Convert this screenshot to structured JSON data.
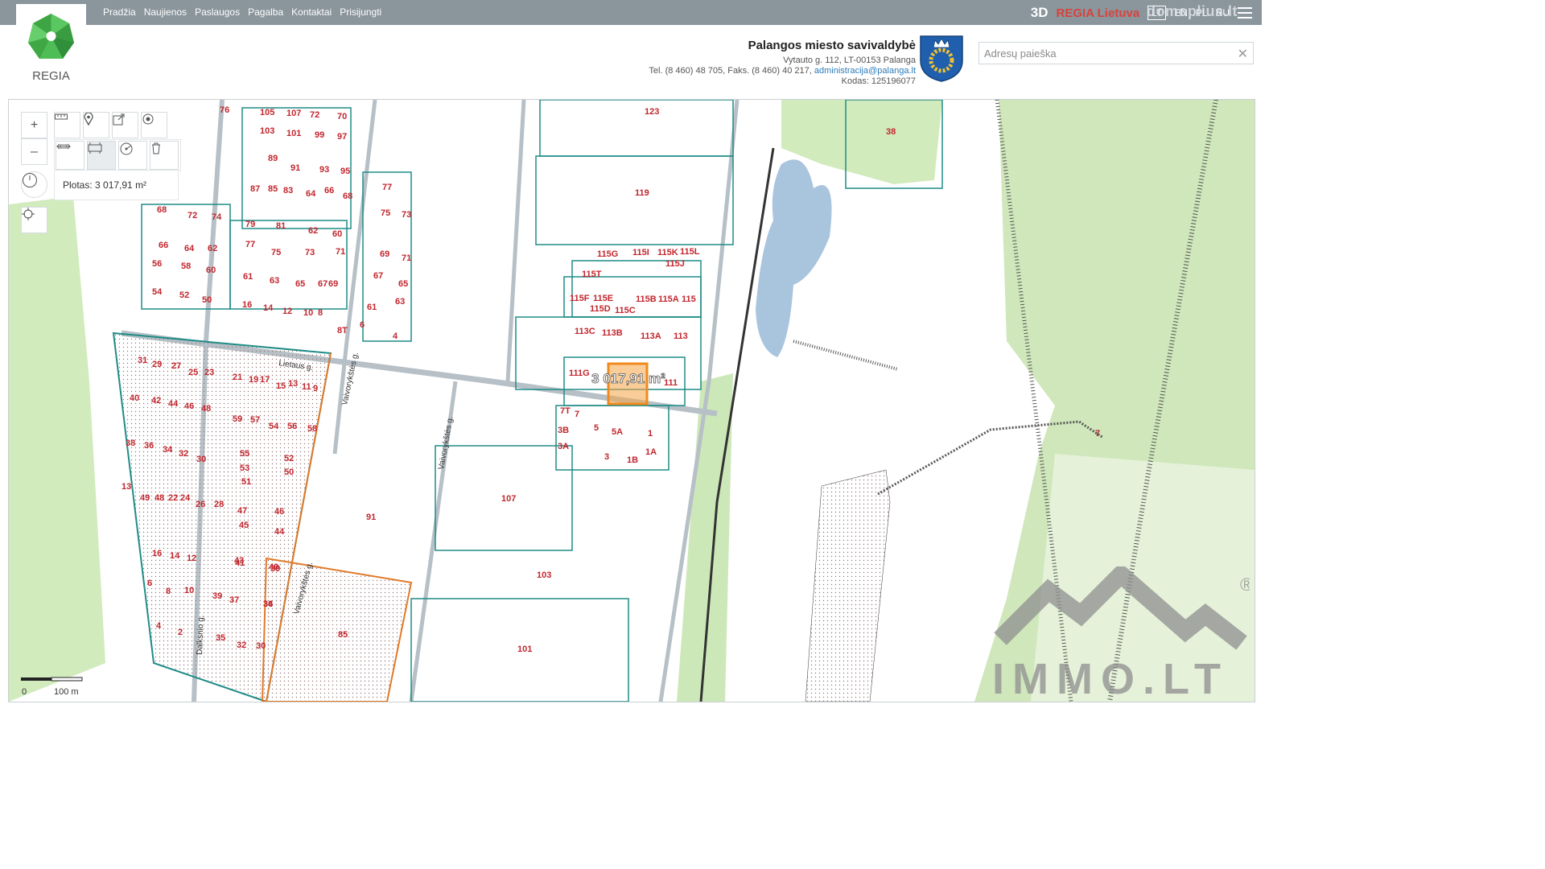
{
  "nav": {
    "items": [
      "Pradžia",
      "Naujienos",
      "Paslaugos",
      "Pagalba",
      "Kontaktai",
      "Prisijungti"
    ]
  },
  "topbar": {
    "btn_3d": "3D",
    "regia_lietuva": "REGIA Lietuva",
    "lang_active": "LT",
    "lang_others": [
      "EN",
      "PL",
      "RU"
    ],
    "watermark": "domoplius.lt",
    "menu_icon": "hamburger-menu-icon"
  },
  "logo": {
    "text": "REGIA",
    "colors": {
      "green": "#44b54b",
      "dark_green": "#2f8f3a"
    }
  },
  "municipality": {
    "name": "Palangos miesto savivaldybė",
    "address": "Vytauto g. 112, LT-00153 Palanga",
    "phone_line": "Tel. (8 460) 48 705, Faks. (8 460) 40 217,",
    "email": "administracija@palanga.lt",
    "code": "Kodas: 125196077",
    "coat_of_arms": "coat-of-arms-icon"
  },
  "search": {
    "placeholder": "Adresų paieška",
    "value": ""
  },
  "map_tools": {
    "zoom_in": "+",
    "zoom_out": "–",
    "area_label": "Plotas: 3 017,91 m²",
    "scale_zero": "0",
    "scale_label": "100 m"
  },
  "map": {
    "highlighted_parcel_label": "3 017,91 m²",
    "highlight_color": "#f5a444",
    "parcel_line_color": "#1f8c86",
    "label_color": "#c2262d",
    "water_color": "#a9c4dd",
    "green_color": "#c8e6b4",
    "street_labels": [
      "Lietaus g.",
      "Vaivorykštės g.",
      "Vaivorykštės g.",
      "Vaivorykštės g.",
      "Dalksnio g."
    ],
    "parcel_labels": [
      "76",
      "105",
      "107",
      "72",
      "70",
      "103",
      "101",
      "99",
      "97",
      "89",
      "91",
      "93",
      "95",
      "87",
      "85",
      "83",
      "64",
      "66",
      "68",
      "68",
      "72",
      "74",
      "79",
      "81",
      "62",
      "60",
      "77",
      "75",
      "73",
      "71",
      "66",
      "64",
      "62",
      "56",
      "58",
      "60",
      "61",
      "63",
      "65",
      "67",
      "69",
      "54",
      "52",
      "50",
      "16",
      "14",
      "12",
      "10",
      "8",
      "8T",
      "77",
      "75",
      "73",
      "69",
      "71",
      "67",
      "65",
      "61",
      "63",
      "6",
      "4",
      "31",
      "29",
      "27",
      "25",
      "23",
      "21",
      "19",
      "17",
      "15",
      "13",
      "11",
      "9",
      "40",
      "42",
      "44",
      "46",
      "48",
      "59",
      "57",
      "54",
      "56",
      "58",
      "38",
      "36",
      "34",
      "32",
      "30",
      "55",
      "53",
      "52",
      "50",
      "13",
      "51",
      "49",
      "48",
      "22",
      "24",
      "26",
      "28",
      "47",
      "46",
      "45",
      "44",
      "16",
      "14",
      "12",
      "43",
      "41",
      "40",
      "39",
      "6",
      "8",
      "10",
      "39",
      "37",
      "34",
      "36",
      "4",
      "2",
      "35",
      "32",
      "30",
      "123",
      "119",
      "38",
      "115G",
      "115I",
      "115K",
      "115L",
      "115J",
      "115T",
      "115F",
      "115E",
      "115D",
      "115C",
      "115B",
      "115A",
      "115",
      "113C",
      "113B",
      "113A",
      "113",
      "111G",
      "111",
      "7T",
      "7",
      "3B",
      "5",
      "5A",
      "1",
      "3A",
      "3",
      "1B",
      "1A",
      "107",
      "91",
      "103",
      "101",
      "85",
      "7"
    ]
  },
  "immo_watermark": {
    "text": "IMMO.LT",
    "registered": "®"
  }
}
